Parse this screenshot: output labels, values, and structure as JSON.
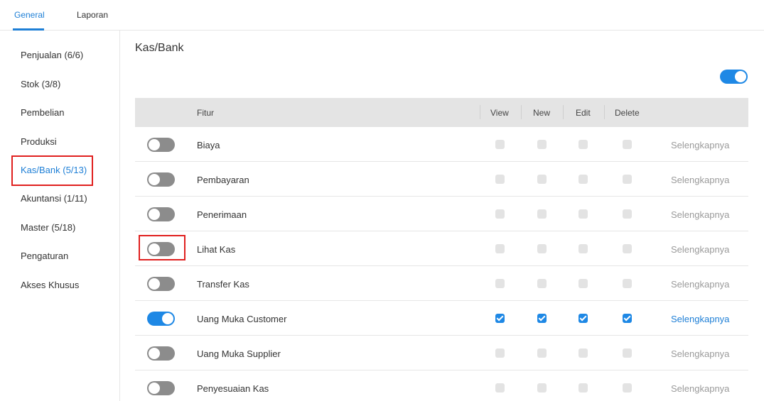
{
  "tabs": [
    {
      "label": "General",
      "active": true
    },
    {
      "label": "Laporan",
      "active": false
    }
  ],
  "sidebar": {
    "items": [
      {
        "label": "Penjualan (6/6)"
      },
      {
        "label": "Stok (3/8)"
      },
      {
        "label": "Pembelian"
      },
      {
        "label": "Produksi"
      },
      {
        "label": "Kas/Bank (5/13)",
        "active": true
      },
      {
        "label": "Akuntansi (1/11)"
      },
      {
        "label": "Master (5/18)"
      },
      {
        "label": "Pengaturan"
      },
      {
        "label": "Akses Khusus"
      }
    ]
  },
  "main": {
    "title": "Kas/Bank",
    "master_toggle_on": true,
    "columns": {
      "fitur": "Fitur",
      "view": "View",
      "new": "New",
      "edit": "Edit",
      "delete": "Delete"
    },
    "rows": [
      {
        "name": "Biaya",
        "enabled": false,
        "view": false,
        "new": false,
        "edit": false,
        "delete": false,
        "more": "Selengkapnya"
      },
      {
        "name": "Pembayaran",
        "enabled": false,
        "view": false,
        "new": false,
        "edit": false,
        "delete": false,
        "more": "Selengkapnya"
      },
      {
        "name": "Penerimaan",
        "enabled": false,
        "view": false,
        "new": false,
        "edit": false,
        "delete": false,
        "more": "Selengkapnya"
      },
      {
        "name": "Lihat Kas",
        "enabled": false,
        "view": false,
        "new": false,
        "edit": false,
        "delete": false,
        "more": "Selengkapnya"
      },
      {
        "name": "Transfer Kas",
        "enabled": false,
        "view": false,
        "new": false,
        "edit": false,
        "delete": false,
        "more": "Selengkapnya"
      },
      {
        "name": "Uang Muka Customer",
        "enabled": true,
        "view": true,
        "new": true,
        "edit": true,
        "delete": true,
        "more": "Selengkapnya"
      },
      {
        "name": "Uang Muka Supplier",
        "enabled": false,
        "view": false,
        "new": false,
        "edit": false,
        "delete": false,
        "more": "Selengkapnya"
      },
      {
        "name": "Penyesuaian Kas",
        "enabled": false,
        "view": false,
        "new": false,
        "edit": false,
        "delete": false,
        "more": "Selengkapnya"
      }
    ]
  },
  "colors": {
    "accent": "#1e88e5",
    "highlight_box": "#e0201f",
    "toggle_off": "#8c8c8c"
  }
}
